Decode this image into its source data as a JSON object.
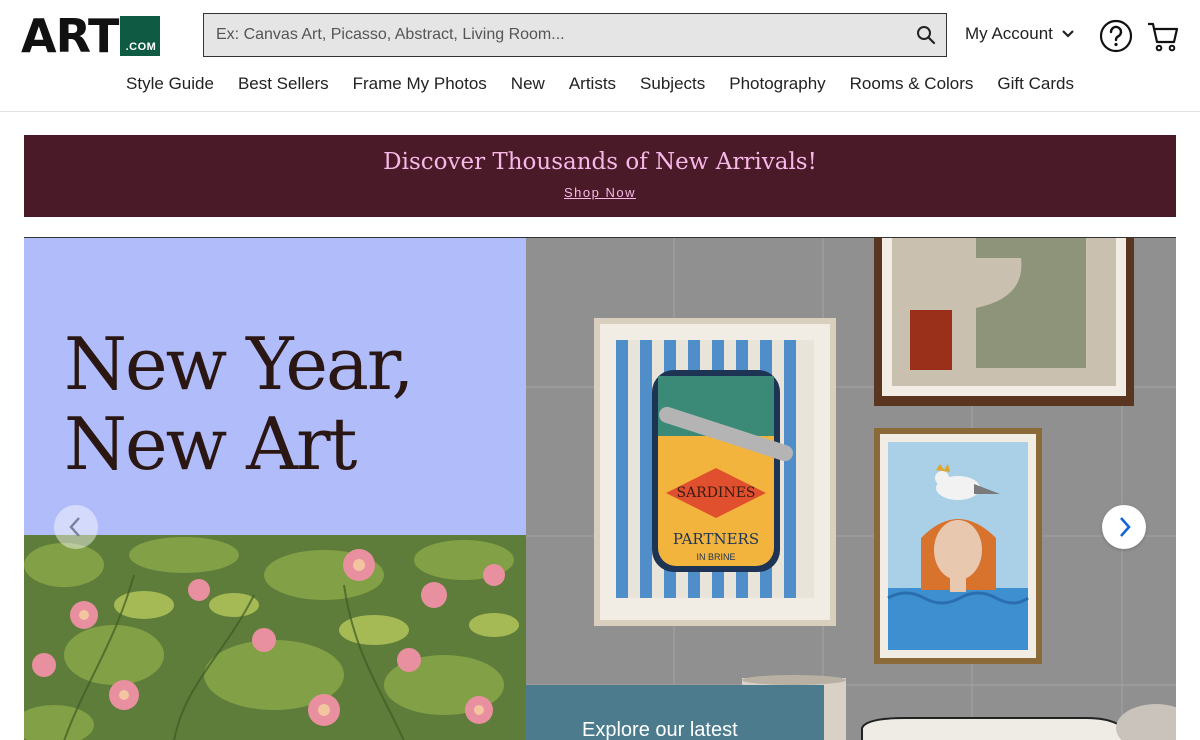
{
  "logo": {
    "brand": "ART",
    "suffix": ".COM"
  },
  "search": {
    "placeholder": "Ex: Canvas Art, Picasso, Abstract, Living Room...",
    "value": ""
  },
  "account": {
    "label": "My Account"
  },
  "icons": {
    "search": "search-icon",
    "account_caret": "chevron-down-icon",
    "help": "help-icon",
    "cart": "cart-icon",
    "prev": "chevron-left-icon",
    "next": "chevron-right-icon"
  },
  "nav": [
    "Style Guide",
    "Best Sellers",
    "Frame My Photos",
    "New",
    "Artists",
    "Subjects",
    "Photography",
    "Rooms & Colors",
    "Gift Cards"
  ],
  "banner": {
    "title": "Discover Thousands of New Arrivals!",
    "link": "Shop Now",
    "bg": "#4a1a28",
    "text_color": "#f7b8e8"
  },
  "hero": {
    "title_line1": "New Year,",
    "title_line2": "New Art",
    "left_bg": "#b1bcfa",
    "art_sardines_label1": "SARDINES",
    "art_sardines_label2": "PARTNERS",
    "art_sardines_label3": "IN BRINE",
    "explore_text": "Explore our latest"
  },
  "colors": {
    "brand_green": "#0e5a42",
    "explore_bg": "#4c7b8e"
  }
}
